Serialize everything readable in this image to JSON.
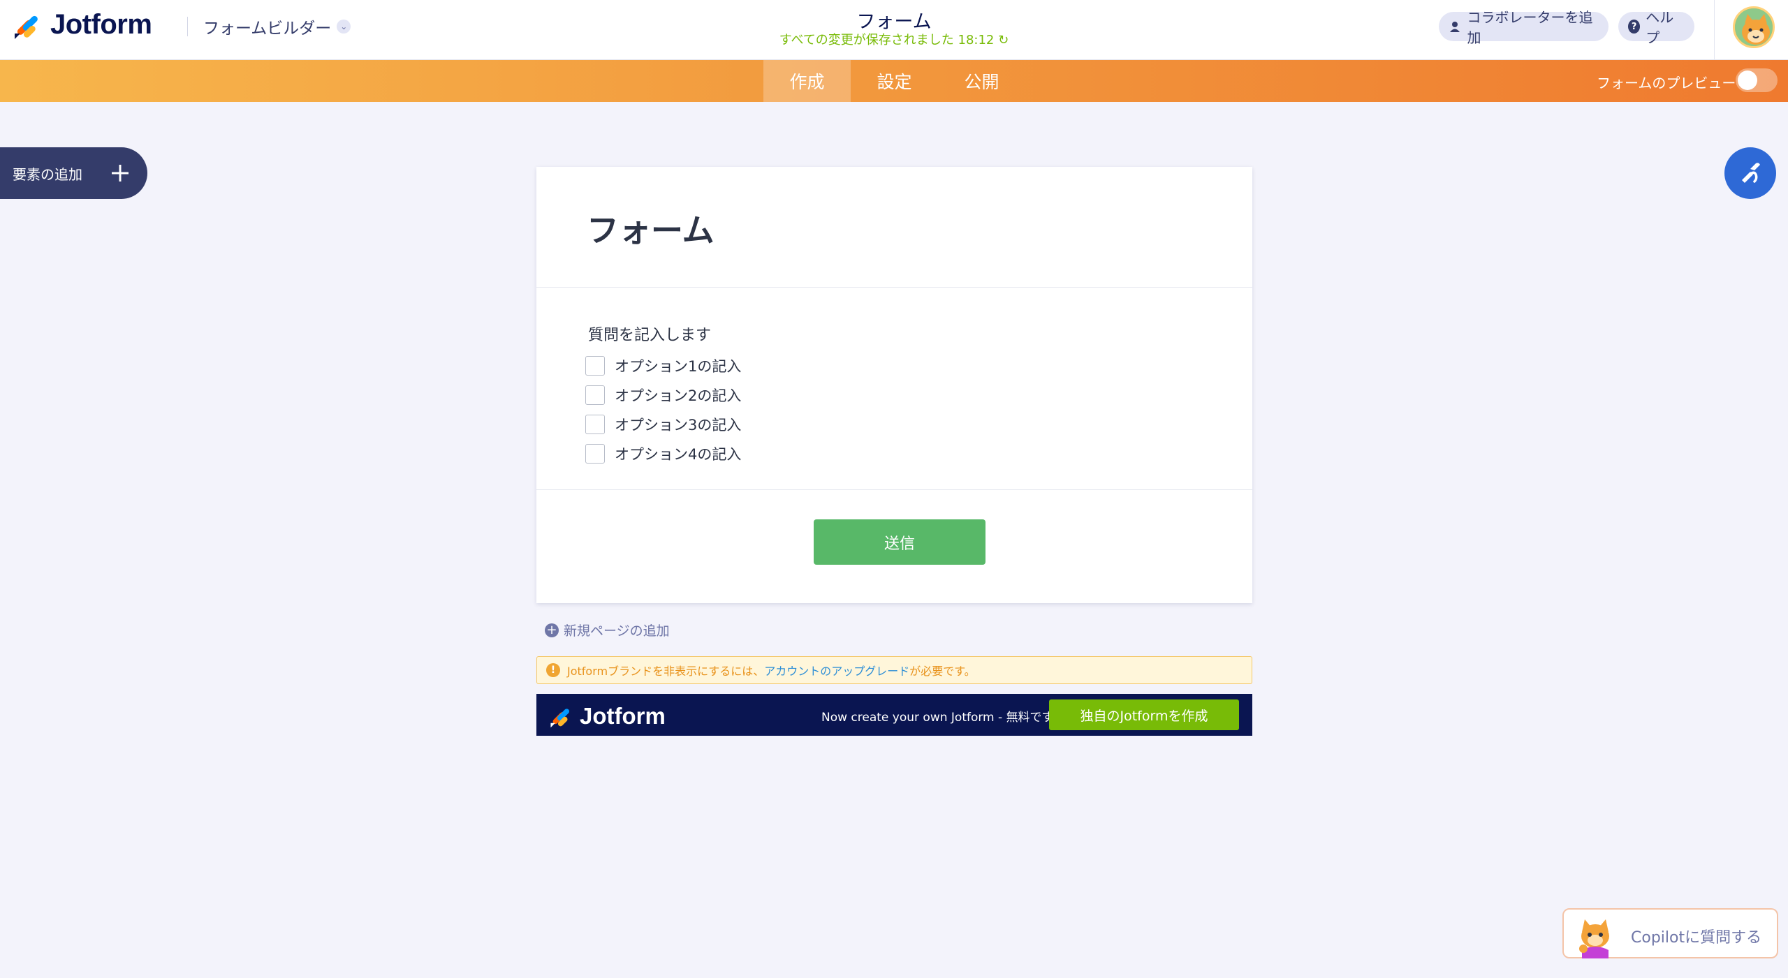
{
  "header": {
    "brand": "Jotform",
    "builder_menu": "フォームビルダー",
    "form_title": "フォーム",
    "save_status": "すべての変更が保存されました 18:12",
    "add_collaborator": "コラボレーターを追加",
    "help": "ヘルプ"
  },
  "nav": {
    "tabs": [
      {
        "label": "作成",
        "active": true
      },
      {
        "label": "設定",
        "active": false
      },
      {
        "label": "公開",
        "active": false
      }
    ],
    "preview_label": "フォームのプレビュー",
    "preview_enabled": false
  },
  "sidebar": {
    "add_element": "要素の追加"
  },
  "form": {
    "heading": "フォーム",
    "question": "質問を記入します",
    "options": [
      "オプション1の記入",
      "オプション2の記入",
      "オプション3の記入",
      "オプション4の記入"
    ],
    "submit": "送信"
  },
  "add_page": "新規ページの追加",
  "warning": {
    "text_before": "Jotformブランドを非表示にするには、",
    "link": "アカウントのアップグレード",
    "text_after": "が必要です。"
  },
  "branding": {
    "logo": "Jotform",
    "tagline": "Now create your own Jotform - 無料です",
    "cta": "独自のJotformを作成"
  },
  "copilot": {
    "label": "Copilotに質問する"
  },
  "colors": {
    "accent_orange": "#f29a3e",
    "navy": "#0a1551",
    "submit_green": "#58b868",
    "cta_green": "#78bb07",
    "designer_blue": "#2e69d6"
  }
}
